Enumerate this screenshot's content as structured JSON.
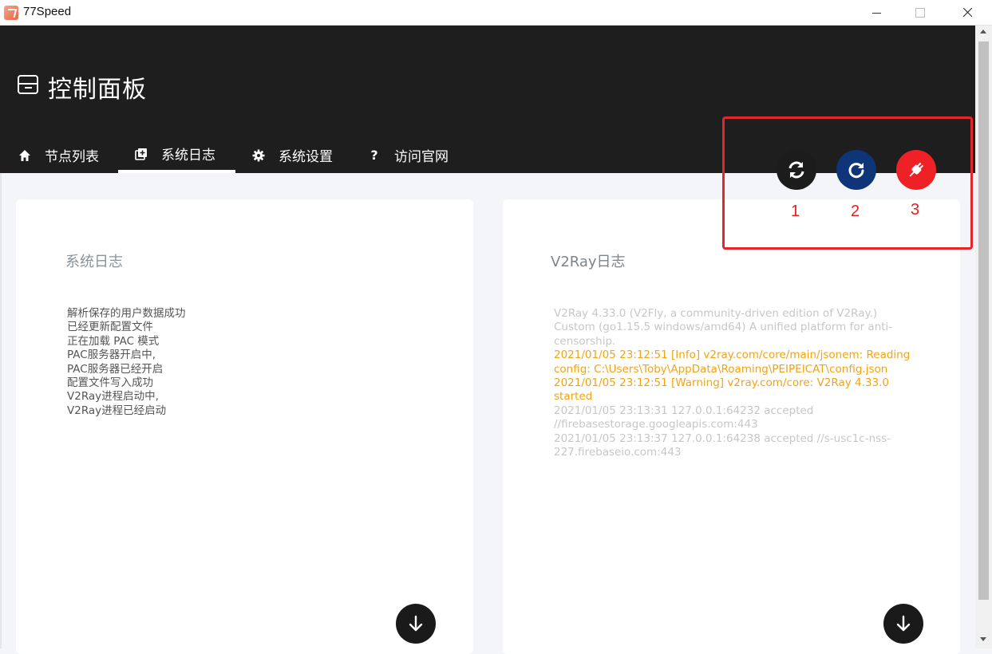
{
  "window": {
    "title": "77Speed"
  },
  "header": {
    "title": "控制面板"
  },
  "tabs": [
    {
      "label": "节点列表",
      "icon": "home-icon"
    },
    {
      "label": "系统日志",
      "icon": "log-icon"
    },
    {
      "label": "系统设置",
      "icon": "gear-icon"
    },
    {
      "label": "访问官网",
      "icon": "question-icon"
    }
  ],
  "actions": {
    "labels": [
      "1",
      "2",
      "3"
    ],
    "colors": [
      "#1c1c1c",
      "#0d3577",
      "#ee2126"
    ]
  },
  "system_log": {
    "title": "系统日志",
    "lines": [
      "解析保存的用户数据成功",
      "已经更新配置文件",
      "正在加载 PAC 模式",
      "PAC服务器开启中,",
      "PAC服务器已经开启",
      "配置文件写入成功",
      "V2Ray进程启动中,",
      "V2Ray进程已经启动"
    ]
  },
  "v2ray_log": {
    "title": "V2Ray日志",
    "lines": [
      {
        "text": "V2Ray 4.33.0 (V2Fly, a community-driven edition of V2Ray.) Custom (go1.15.5 windows/amd64) A unified platform for anti-censorship.",
        "level": "normal"
      },
      {
        "text": "2021/01/05 23:12:51 [Info] v2ray.com/core/main/jsonem: Reading config: C:\\Users\\Toby\\AppData\\Roaming\\PEIPEICAT\\config.json",
        "level": "info"
      },
      {
        "text": "2021/01/05 23:12:51 [Warning] v2ray.com/core: V2Ray 4.33.0 started",
        "level": "warn"
      },
      {
        "text": "2021/01/05 23:13:31 127.0.0.1:64232 accepted //firebasestorage.googleapis.com:443",
        "level": "normal"
      },
      {
        "text": "2021/01/05 23:13:37 127.0.0.1:64238 accepted //s-usc1c-nss-227.firebaseio.com:443",
        "level": "normal"
      }
    ]
  }
}
